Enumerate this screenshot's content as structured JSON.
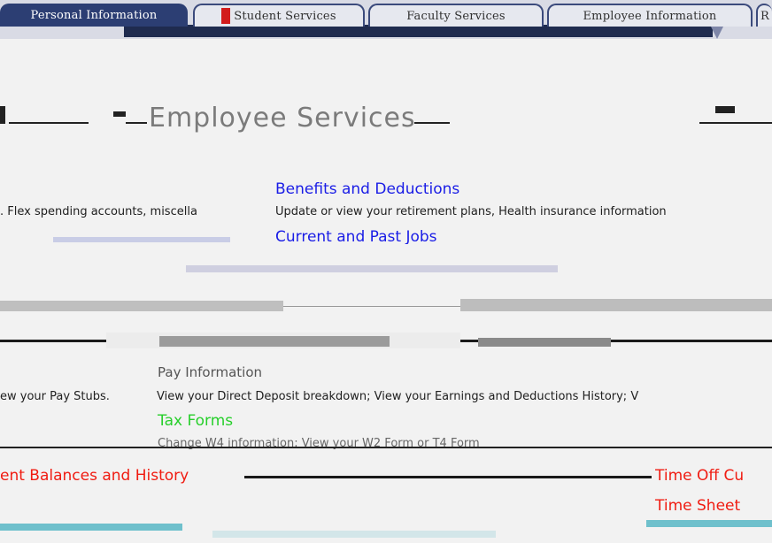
{
  "tabs": [
    {
      "label": "Personal Information"
    },
    {
      "label": "Student Services"
    },
    {
      "label": "Faculty Services"
    },
    {
      "label": "Employee Information"
    },
    {
      "label": "R"
    }
  ],
  "page": {
    "title": "Employee Services"
  },
  "sections": {
    "left_truncated_desc": ". Flex spending accounts, miscella",
    "benefits": {
      "title": "Benefits and Deductions",
      "desc": "Update or view your retirement plans, Health insurance information"
    },
    "current_jobs": {
      "title": "Current and Past Jobs"
    },
    "pay_info": {
      "title": "Pay Information",
      "left_desc": "ew your Pay Stubs.",
      "desc": "View your Direct Deposit breakdown; View your Earnings and Deductions History; V"
    },
    "tax_forms": {
      "title": "Tax Forms",
      "desc": "Change W4 information; View your W2 Form or T4 Form"
    },
    "leave": {
      "left_title": "ent Balances and History",
      "right_title": "Time Off Cu",
      "time_sheet": "Time Sheet"
    }
  }
}
